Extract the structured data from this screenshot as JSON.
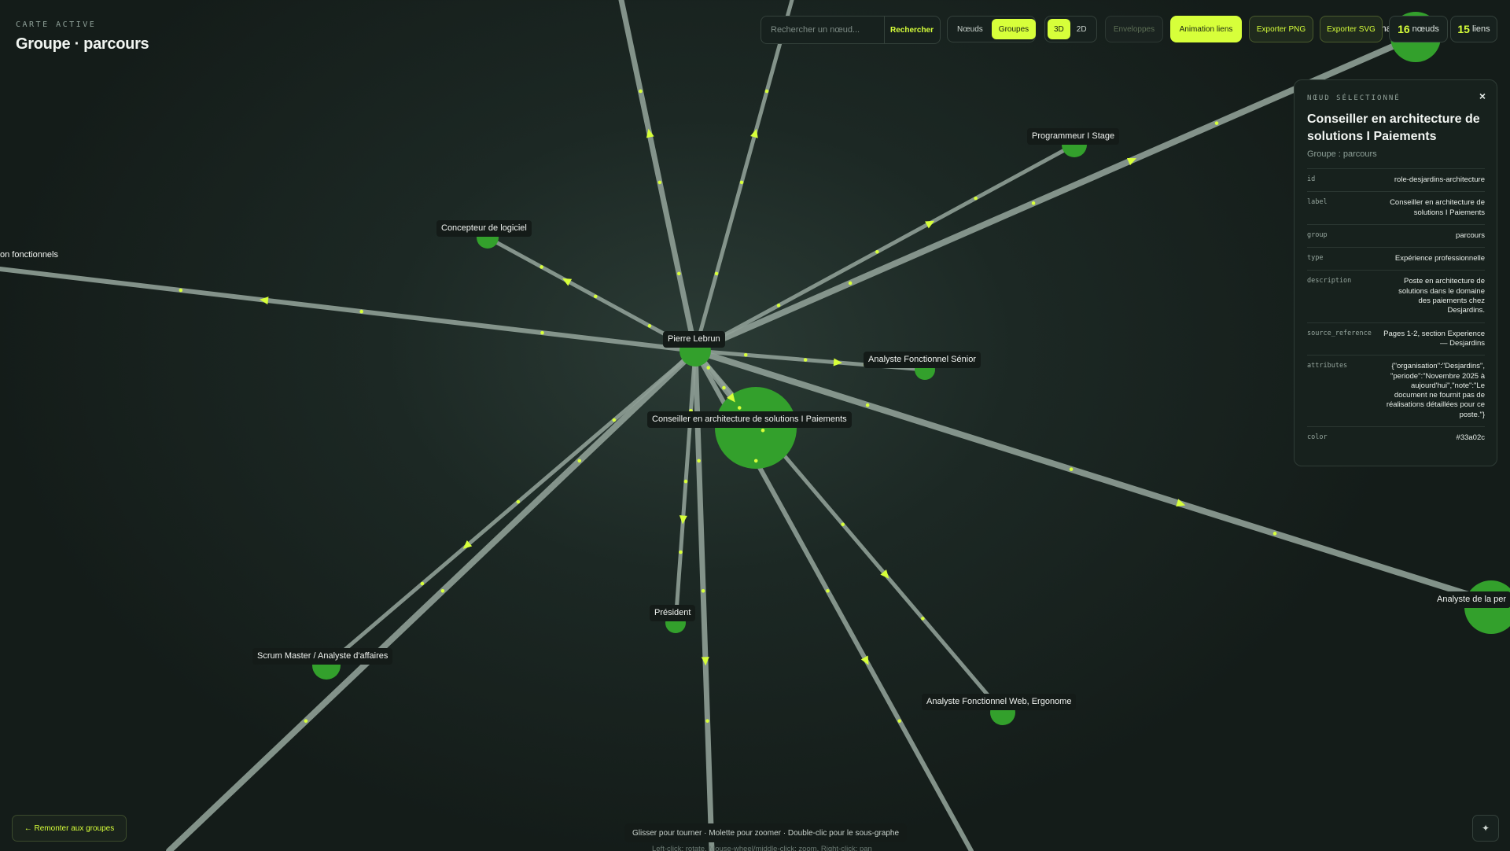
{
  "header": {
    "kicker": "CARTE ACTIVE",
    "title": "Groupe · parcours"
  },
  "toolbar": {
    "search_placeholder": "Rechercher un nœud...",
    "search_button": "Rechercher",
    "mode_nodes": "Nœuds",
    "mode_groups": "Groupes",
    "view_3d": "3D",
    "view_2d": "2D",
    "envelopes": "Enveloppes",
    "animation_links": "Animation liens",
    "export_png": "Exporter PNG",
    "export_svg": "Exporter SVG",
    "nodes_count": "16",
    "nodes_unit": "nœuds",
    "links_count": "15",
    "links_unit": "liens"
  },
  "graph": {
    "node_color": "#33a02c",
    "edge_color": "#8f9f96",
    "particle_color": "#d7ff3a",
    "labels": {
      "center": "Pierre Lebrun",
      "selected": "Conseiller en architecture de solutions I Paiements",
      "n_prog": "Programmeur I Stage",
      "n_concept": "Concepteur de logiciel",
      "n_fonct": "on fonctionnels",
      "n_senior": "Analyste Fonctionnel Sénior",
      "n_president": "Président",
      "n_scrum": "Scrum Master / Analyste d'affaires",
      "n_web": "Analyste Fonctionnel Web, Ergonome",
      "n_perf": "Analyste de la per",
      "n_topright": "Ana"
    }
  },
  "panel": {
    "kicker": "NŒUD SÉLECTIONNÉ",
    "close": "×",
    "title": "Conseiller en architecture de solutions I Paiements",
    "subtitle": "Groupe : parcours",
    "rows": [
      {
        "key": "id",
        "value": "role-desjardins-architecture"
      },
      {
        "key": "label",
        "value": "Conseiller en architecture de solutions I Paiements"
      },
      {
        "key": "group",
        "value": "parcours"
      },
      {
        "key": "type",
        "value": "Expérience professionnelle"
      },
      {
        "key": "description",
        "value": "Poste en architecture de solutions dans le domaine des paiements chez Desjardins."
      },
      {
        "key": "source_reference",
        "value": "Pages 1-2, section Experience — Desjardins"
      },
      {
        "key": "attributes",
        "value": "{\"organisation\":\"Desjardins\", \"periode\":\"Novembre 2025 à aujourd'hui\",\"note\":\"Le document ne fournit pas de réalisations détaillées pour ce poste.\"}"
      },
      {
        "key": "color",
        "value": "#33a02c"
      }
    ]
  },
  "footer": {
    "back_button": "← Remonter aux groupes",
    "hint": "Glisser pour tourner · Molette pour zoomer · Double-clic pour le sous-graphe",
    "hint_secondary": "Left-click: rotate, Mouse-wheel/middle-click: zoom, Right-click: pan",
    "corner_icon": "✦"
  }
}
